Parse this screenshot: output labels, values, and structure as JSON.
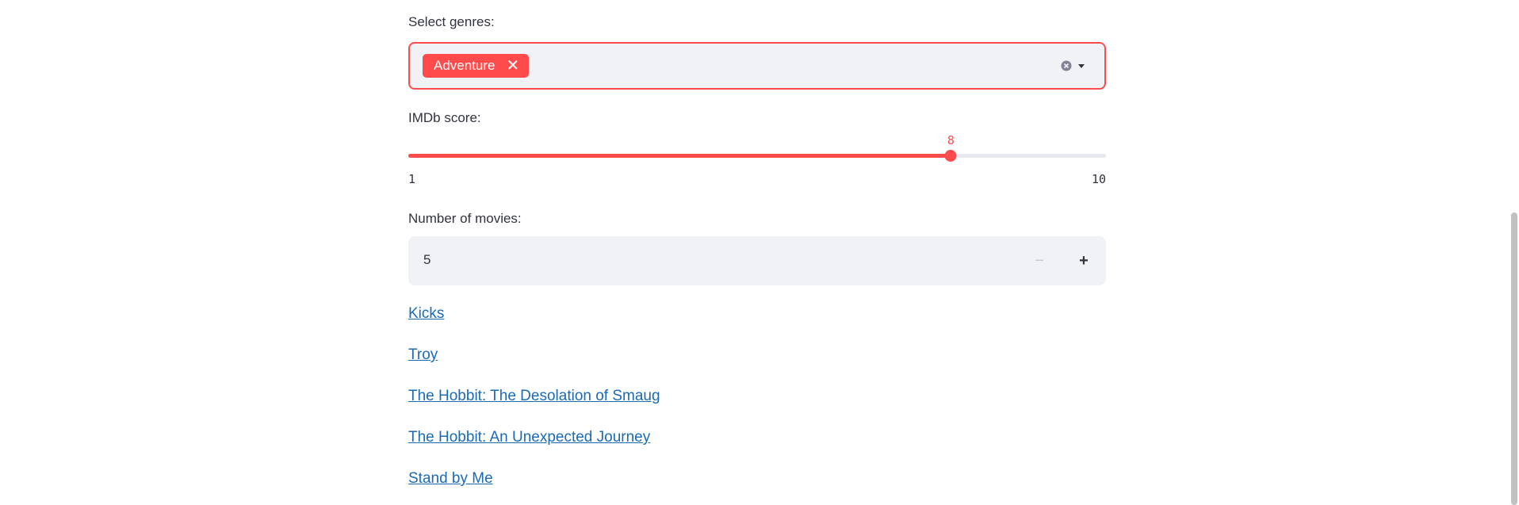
{
  "genres": {
    "label": "Select genres:",
    "selected": [
      "Adventure"
    ]
  },
  "imdb": {
    "label": "IMDb score:",
    "value": 8,
    "min": 1,
    "max": 10,
    "min_label": "1",
    "max_label": "10",
    "value_label": "8"
  },
  "movies_count": {
    "label": "Number of movies:",
    "value": "5",
    "minus_label": "−",
    "plus_label": "+"
  },
  "movies": [
    "Kicks",
    "Troy",
    "The Hobbit: The Desolation of Smaug",
    "The Hobbit: An Unexpected Journey",
    "Stand by Me"
  ],
  "colors": {
    "accent": "#ff4b4b",
    "input_bg": "#f0f2f6",
    "link": "#1a6ab6",
    "text": "#31333f"
  }
}
